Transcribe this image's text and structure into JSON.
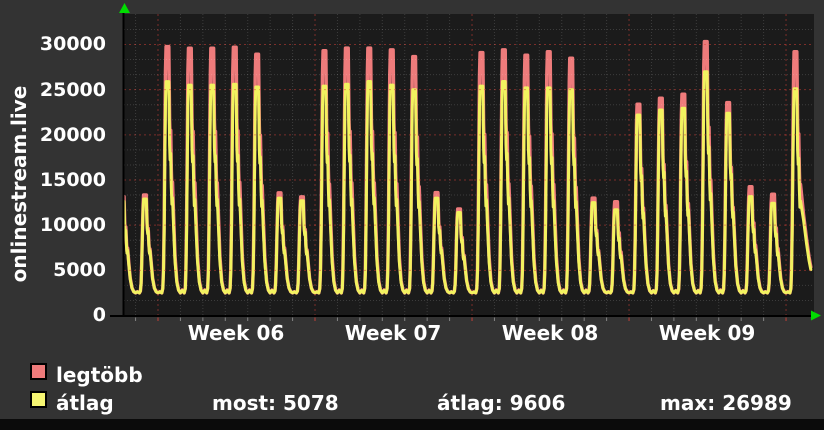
{
  "branding": {
    "site_label": "onlinestream.live"
  },
  "axes": {
    "y_labels": [
      "30000",
      "25000",
      "20000",
      "15000",
      "10000",
      "5000",
      "0"
    ],
    "week_labels": [
      "Week 06",
      "Week 07",
      "Week 08",
      "Week 09"
    ]
  },
  "legend": {
    "items": [
      {
        "label": "legtöbb",
        "color": "#ee7b7b"
      },
      {
        "label": "átlag",
        "color": "#f6f672"
      }
    ]
  },
  "stats": {
    "items": [
      {
        "label": "most:",
        "value": "5078"
      },
      {
        "label": "átlag:",
        "value": "9606"
      },
      {
        "label": "max:",
        "value": "26989"
      }
    ]
  },
  "chart_data": {
    "type": "line",
    "title": "",
    "ylabel": "",
    "xlabel": "",
    "ylim": [
      0,
      32000
    ],
    "y_ticks": [
      0,
      5000,
      10000,
      15000,
      20000,
      25000,
      30000
    ],
    "x_axis_weeks": [
      "Week 06",
      "Week 07",
      "Week 08",
      "Week 09"
    ],
    "days_per_week": 7,
    "start_day": "Saturday, 1.5 days before Week 06 monday",
    "night_low": 2500,
    "grid": {
      "major_color": "#c8463c",
      "minor_color": "#5a5a5a",
      "style": "dashed"
    },
    "legend_position": "bottom-left",
    "summary": {
      "most": 5078,
      "atlag": 9606,
      "max": 26989
    },
    "series": [
      {
        "name": "legtöbb",
        "color": "#ee7b7b",
        "daily_peaks": [
          13560,
          13340,
          29770,
          29590,
          29590,
          29700,
          28930,
          13570,
          13130,
          29300,
          29600,
          29600,
          29400,
          28660,
          13600,
          11790,
          29100,
          29400,
          28800,
          29200,
          28480,
          13000,
          12600,
          23390,
          24050,
          24490,
          30320,
          23570,
          14260,
          13420,
          29200
        ],
        "final_descent": [
          [
            0.61,
            11200
          ],
          [
            0.745,
            8400
          ],
          [
            0.855,
            6500
          ],
          [
            0.935,
            5380
          ]
        ]
      },
      {
        "name": "átlag",
        "color": "#f2f25f",
        "daily_peaks": [
          13000,
          12900,
          25890,
          25500,
          25500,
          25600,
          25300,
          13000,
          12700,
          25400,
          25600,
          25900,
          25500,
          25000,
          13000,
          11400,
          25400,
          25900,
          25200,
          25200,
          25000,
          12500,
          11700,
          22200,
          22750,
          22940,
          26989,
          22390,
          13160,
          12420,
          25100
        ],
        "final_descent": [
          [
            0.61,
            10600
          ],
          [
            0.745,
            7900
          ],
          [
            0.855,
            6100
          ],
          [
            0.935,
            5078
          ]
        ]
      }
    ],
    "daily_profile_normalized": [
      [
        0,
        0
      ],
      [
        0.045,
        0.02
      ],
      [
        0.075,
        0.1
      ],
      [
        0.105,
        0.3
      ],
      [
        0.135,
        0.62
      ],
      [
        0.165,
        0.9
      ],
      [
        0.19,
        1
      ],
      [
        0.31,
        1
      ],
      [
        0.345,
        0.7
      ],
      [
        0.37,
        0.63
      ],
      [
        0.395,
        0.66
      ],
      [
        0.425,
        0.5
      ],
      [
        0.45,
        0.42
      ],
      [
        0.475,
        0.45
      ],
      [
        0.53,
        0.3
      ],
      [
        0.59,
        0.15
      ],
      [
        0.67,
        0.05
      ],
      [
        0.75,
        0.012
      ],
      [
        0.83,
        0
      ],
      [
        0.91,
        0.012
      ],
      [
        1,
        0
      ]
    ]
  }
}
